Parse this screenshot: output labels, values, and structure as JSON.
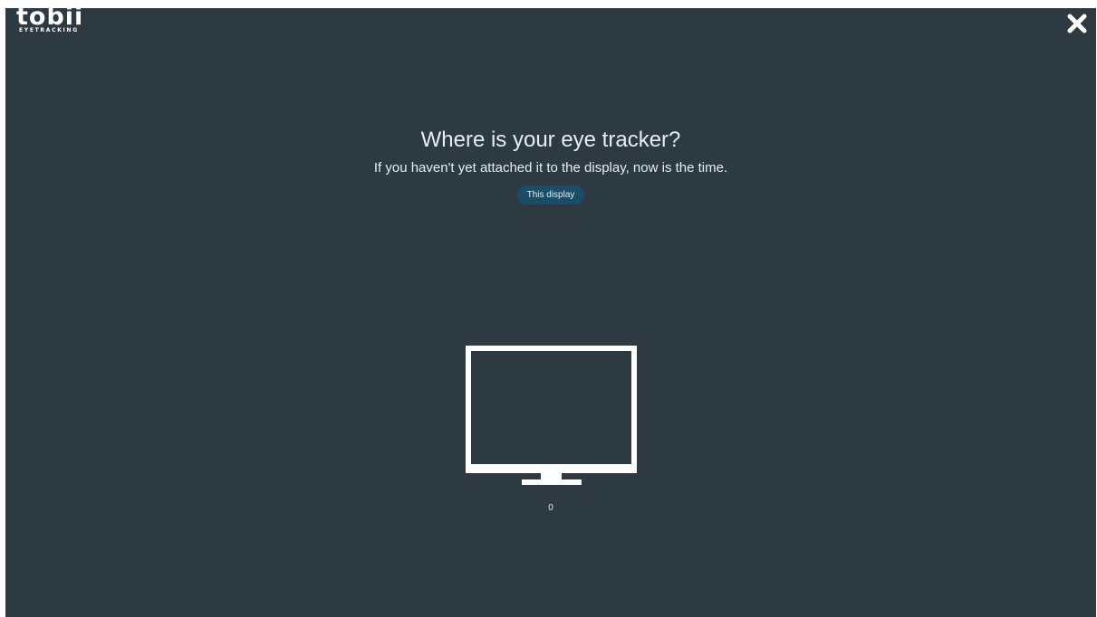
{
  "app": {
    "logo_text": "tobii",
    "logo_subtext": "EYETRACKING"
  },
  "header": {
    "close_icon": "close-icon"
  },
  "main": {
    "title": "Where is your eye tracker?",
    "subtitle": "If you haven't yet attached it to the display, now is the time.",
    "display_button_label": "This display",
    "monitor_icon": "monitor-icon",
    "monitor_index": "0"
  },
  "colors": {
    "background": "#2e3a42",
    "button": "#1a4e68",
    "text": "#e4edf2"
  }
}
